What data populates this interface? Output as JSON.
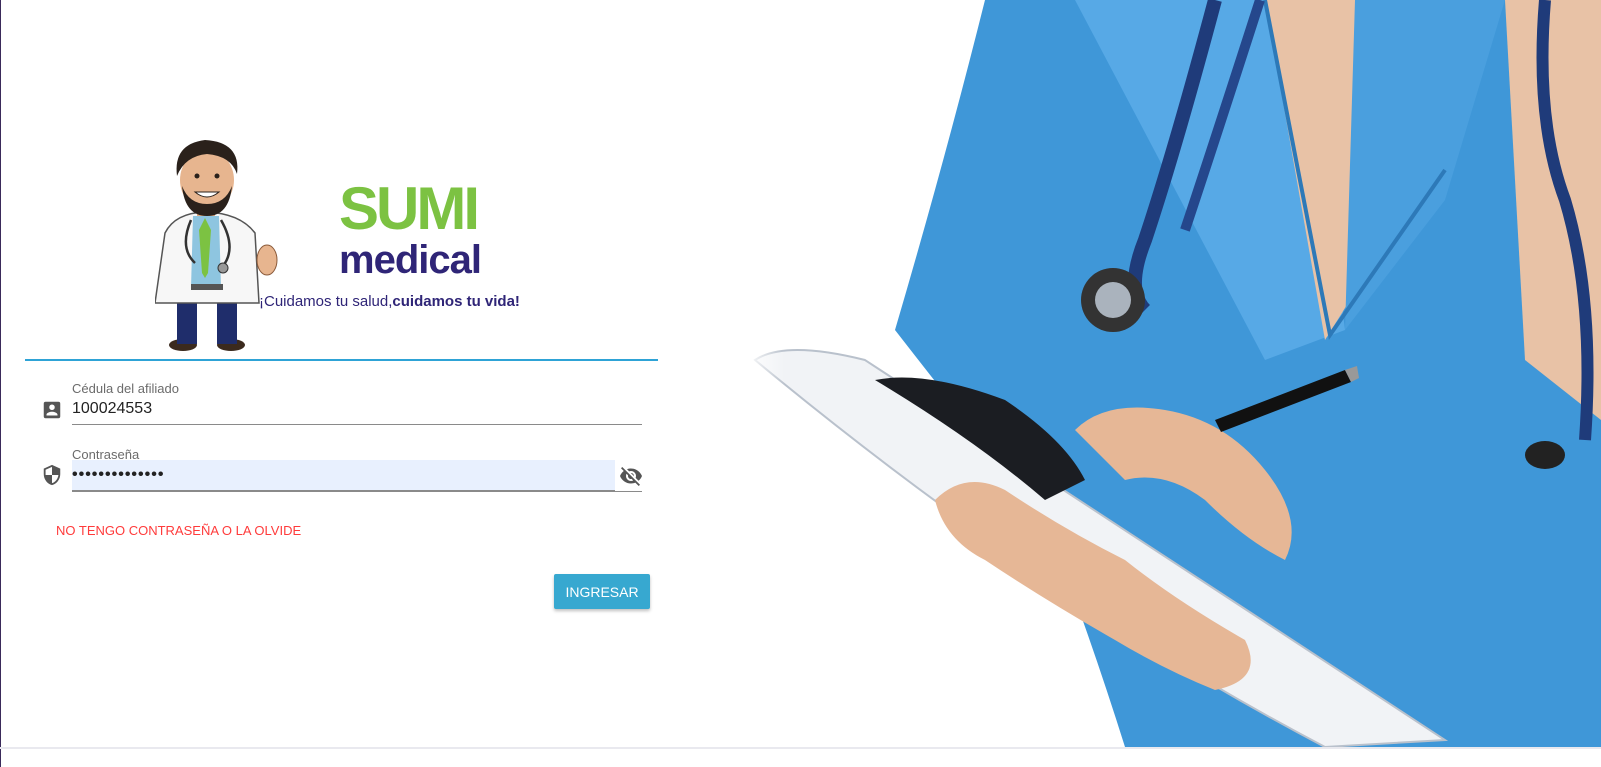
{
  "brand": {
    "name_line1": "SUMI",
    "name_line2": "medical",
    "tagline_regular": "¡Cuidamos tu salud,",
    "tagline_bold": "cuidamos tu vida!",
    "green": "#7cc242",
    "purple": "#2f2577"
  },
  "form": {
    "id_label": "Cédula del afiliado",
    "id_value": "100024553",
    "password_label": "Contraseña",
    "password_value": "••••••••••••••",
    "forgot_link": "NO TENGO CONTRASEÑA O LA OLVIDE",
    "submit_label": "INGRESAR"
  },
  "icons": {
    "id": "account-box-icon",
    "password": "shield-icon",
    "toggle": "visibility-off-icon"
  },
  "colors": {
    "accent": "#37a8d0",
    "divider": "#2ea3d6",
    "error_link": "#ff3b3b",
    "autofill_bg": "#e8f0fe"
  }
}
